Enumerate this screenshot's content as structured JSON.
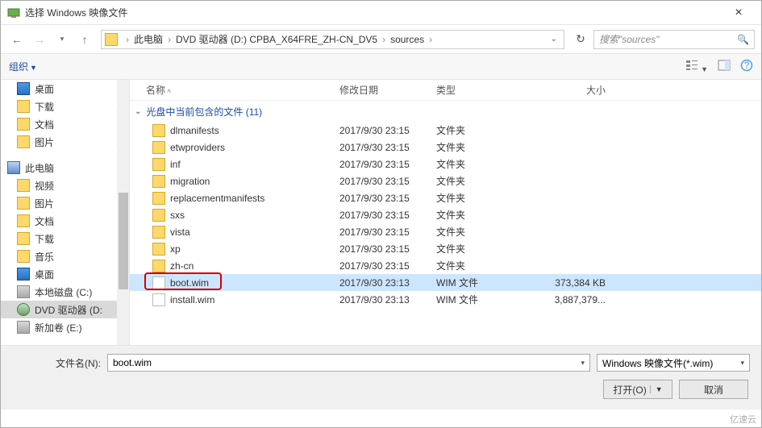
{
  "window": {
    "title": "选择 Windows 映像文件",
    "close": "×"
  },
  "nav": {
    "breadcrumb": [
      "此电脑",
      "DVD 驱动器 (D:) CPBA_X64FRE_ZH-CN_DV5",
      "sources"
    ],
    "search_placeholder": "搜索\"sources\""
  },
  "toolbar": {
    "organize": "组织"
  },
  "tree": {
    "quick": [
      {
        "label": "桌面",
        "icon": "monitor"
      },
      {
        "label": "下载",
        "icon": "folder"
      },
      {
        "label": "文档",
        "icon": "folder"
      },
      {
        "label": "图片",
        "icon": "folder"
      }
    ],
    "this_pc_label": "此电脑",
    "pc": [
      {
        "label": "视频",
        "icon": "folder"
      },
      {
        "label": "图片",
        "icon": "folder"
      },
      {
        "label": "文档",
        "icon": "folder"
      },
      {
        "label": "下载",
        "icon": "folder"
      },
      {
        "label": "音乐",
        "icon": "folder"
      },
      {
        "label": "桌面",
        "icon": "monitor"
      },
      {
        "label": "本地磁盘 (C:)",
        "icon": "drive"
      },
      {
        "label": "DVD 驱动器 (D:",
        "icon": "dvd",
        "selected": true
      },
      {
        "label": "新加卷 (E:)",
        "icon": "drive"
      }
    ]
  },
  "columns": {
    "name": "名称",
    "date": "修改日期",
    "type": "类型",
    "size": "大小"
  },
  "group": {
    "label": "光盘中当前包含的文件 (11)"
  },
  "files": [
    {
      "name": "dlmanifests",
      "date": "2017/9/30 23:15",
      "type": "文件夹",
      "size": "",
      "icon": "folder"
    },
    {
      "name": "etwproviders",
      "date": "2017/9/30 23:15",
      "type": "文件夹",
      "size": "",
      "icon": "folder"
    },
    {
      "name": "inf",
      "date": "2017/9/30 23:15",
      "type": "文件夹",
      "size": "",
      "icon": "folder"
    },
    {
      "name": "migration",
      "date": "2017/9/30 23:15",
      "type": "文件夹",
      "size": "",
      "icon": "folder"
    },
    {
      "name": "replacementmanifests",
      "date": "2017/9/30 23:15",
      "type": "文件夹",
      "size": "",
      "icon": "folder"
    },
    {
      "name": "sxs",
      "date": "2017/9/30 23:15",
      "type": "文件夹",
      "size": "",
      "icon": "folder"
    },
    {
      "name": "vista",
      "date": "2017/9/30 23:15",
      "type": "文件夹",
      "size": "",
      "icon": "folder"
    },
    {
      "name": "xp",
      "date": "2017/9/30 23:15",
      "type": "文件夹",
      "size": "",
      "icon": "folder"
    },
    {
      "name": "zh-cn",
      "date": "2017/9/30 23:15",
      "type": "文件夹",
      "size": "",
      "icon": "folder"
    },
    {
      "name": "boot.wim",
      "date": "2017/9/30 23:13",
      "type": "WIM 文件",
      "size": "373,384 KB",
      "icon": "file",
      "selected": true,
      "highlight": true
    },
    {
      "name": "install.wim",
      "date": "2017/9/30 23:13",
      "type": "WIM 文件",
      "size": "3,887,379...",
      "icon": "file"
    }
  ],
  "footer": {
    "filename_label": "文件名(N):",
    "filename_value": "boot.wim",
    "filter": "Windows 映像文件(*.wim)",
    "open": "打开(O)",
    "cancel": "取消"
  },
  "watermark": "亿速云"
}
